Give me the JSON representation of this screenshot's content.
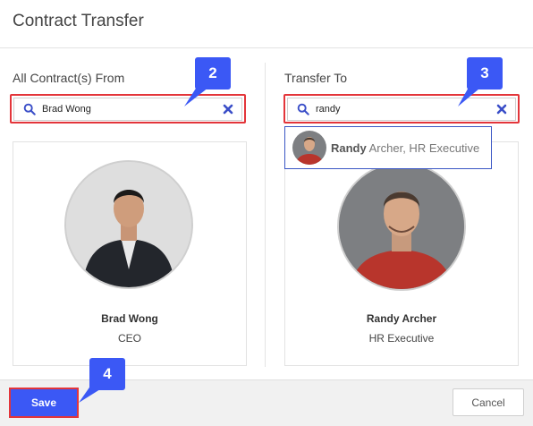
{
  "dialog": {
    "title": "Contract Transfer"
  },
  "from": {
    "label": "All Contract(s) From",
    "search_value": "Brad Wong",
    "person": {
      "name": "Brad Wong",
      "role": "CEO"
    }
  },
  "to": {
    "label": "Transfer To",
    "search_value": "randy",
    "suggestion": {
      "match": "Randy",
      "rest": " Archer, HR Executive"
    },
    "person": {
      "name": "Randy Archer",
      "role": "HR Executive"
    }
  },
  "callouts": {
    "c2": "2",
    "c3": "3",
    "c4": "4"
  },
  "footer": {
    "save_label": "Save",
    "cancel_label": "Cancel"
  },
  "icons": {
    "search": "search-icon",
    "clear": "close-icon"
  },
  "colors": {
    "accent": "#3b58f5",
    "highlight": "#e3353a",
    "dropdown_border": "#3a56c4"
  }
}
